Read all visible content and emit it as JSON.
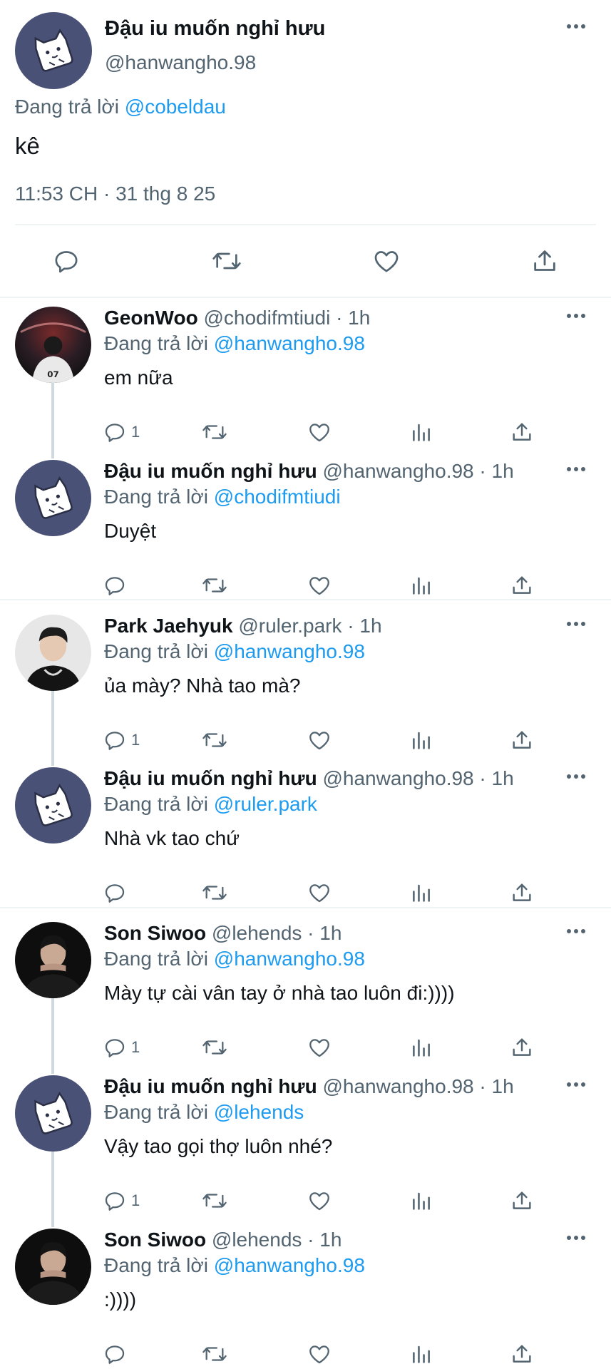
{
  "main_tweet": {
    "name": "Đậu iu muốn nghỉ hưu",
    "handle": "@hanwangho.98",
    "reply_prefix": "Đang trả lời",
    "reply_to": "@cobeldau",
    "text": "kê",
    "timestamp": "11:53 CH · 31 thg 8 25",
    "actions": [
      "reply-icon",
      "retweet-icon",
      "like-icon",
      "share-icon"
    ]
  },
  "replies": [
    {
      "name": "GeonWoo",
      "handle": "@chodifmtiudi · 1h",
      "reply_prefix": "Đang trả lời",
      "reply_to": "@hanwangho.98",
      "text": "em nữa",
      "reply_count": "1",
      "avatar": "photo-dark-arena"
    },
    {
      "name": "Đậu iu muốn nghỉ hưu",
      "handle": "@hanwangho.98 · 1h",
      "reply_prefix": "Đang trả lời",
      "reply_to": "@chodifmtiudi",
      "text": "Duyệt",
      "reply_count": "",
      "avatar": "cat-logo"
    },
    {
      "name": "Park Jaehyuk",
      "handle": "@ruler.park · 1h",
      "reply_prefix": "Đang trả lời",
      "reply_to": "@hanwangho.98",
      "text": "ủa mày? Nhà tao mà?",
      "reply_count": "1",
      "avatar": "photo-light"
    },
    {
      "name": "Đậu iu muốn nghỉ hưu",
      "handle": "@hanwangho.98 · 1h",
      "reply_prefix": "Đang trả lời",
      "reply_to": "@ruler.park",
      "text": "Nhà vk tao chứ",
      "reply_count": "",
      "avatar": "cat-logo"
    },
    {
      "name": "Son Siwoo",
      "handle": "@lehends · 1h",
      "reply_prefix": "Đang trả lời",
      "reply_to": "@hanwangho.98",
      "text": "Mày tự cài vân tay ở nhà tao luôn đi:))))",
      "reply_count": "1",
      "avatar": "photo-dark"
    },
    {
      "name": "Đậu iu muốn nghỉ hưu",
      "handle": "@hanwangho.98 · 1h",
      "reply_prefix": "Đang trả lời",
      "reply_to": "@lehends",
      "text": "Vậy tao gọi thợ luôn nhé?",
      "reply_count": "1",
      "avatar": "cat-logo"
    },
    {
      "name": "Son Siwoo",
      "handle": "@lehends · 1h",
      "reply_prefix": "Đang trả lời",
      "reply_to": "@hanwangho.98",
      "text": ":))))",
      "reply_count": "",
      "avatar": "photo-dark"
    }
  ],
  "colors": {
    "accent": "#1d9bf0",
    "muted": "#536471",
    "avatar_bg": "#495177",
    "divider": "#eff3f4"
  }
}
